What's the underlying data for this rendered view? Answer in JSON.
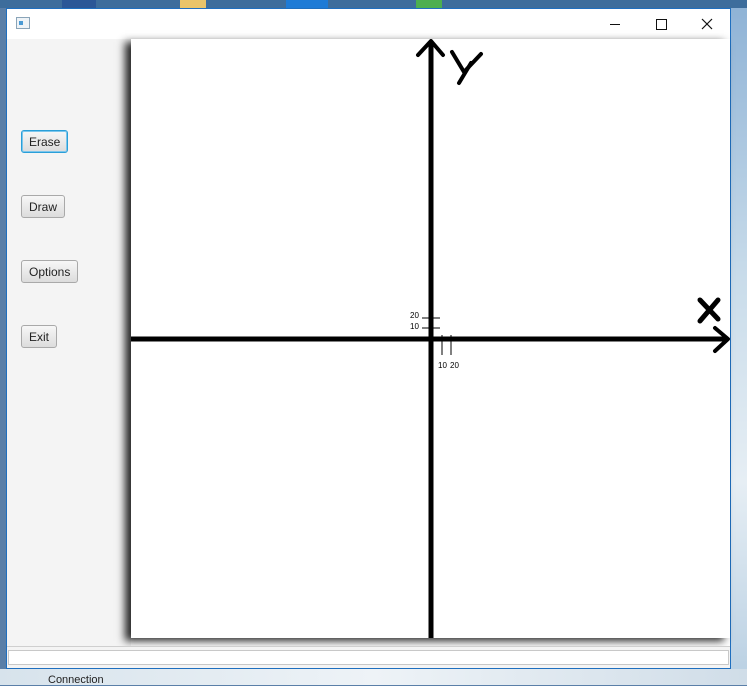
{
  "window": {
    "title": ""
  },
  "sidebar": {
    "buttons": [
      {
        "label": "Erase"
      },
      {
        "label": "Draw"
      },
      {
        "label": "Options"
      },
      {
        "label": "Exit"
      }
    ]
  },
  "graph": {
    "axis_x_label": "X",
    "axis_y_label": "Y",
    "x_ticks": [
      "10",
      "20"
    ],
    "y_ticks": [
      "10",
      "20"
    ]
  },
  "statusbar": {
    "value": ""
  },
  "desktop": {
    "taskbar_text": "Connection"
  },
  "colors": {
    "window_border": "#1f6fbf",
    "axis": "#000000",
    "focus": "#2a9fd8"
  }
}
